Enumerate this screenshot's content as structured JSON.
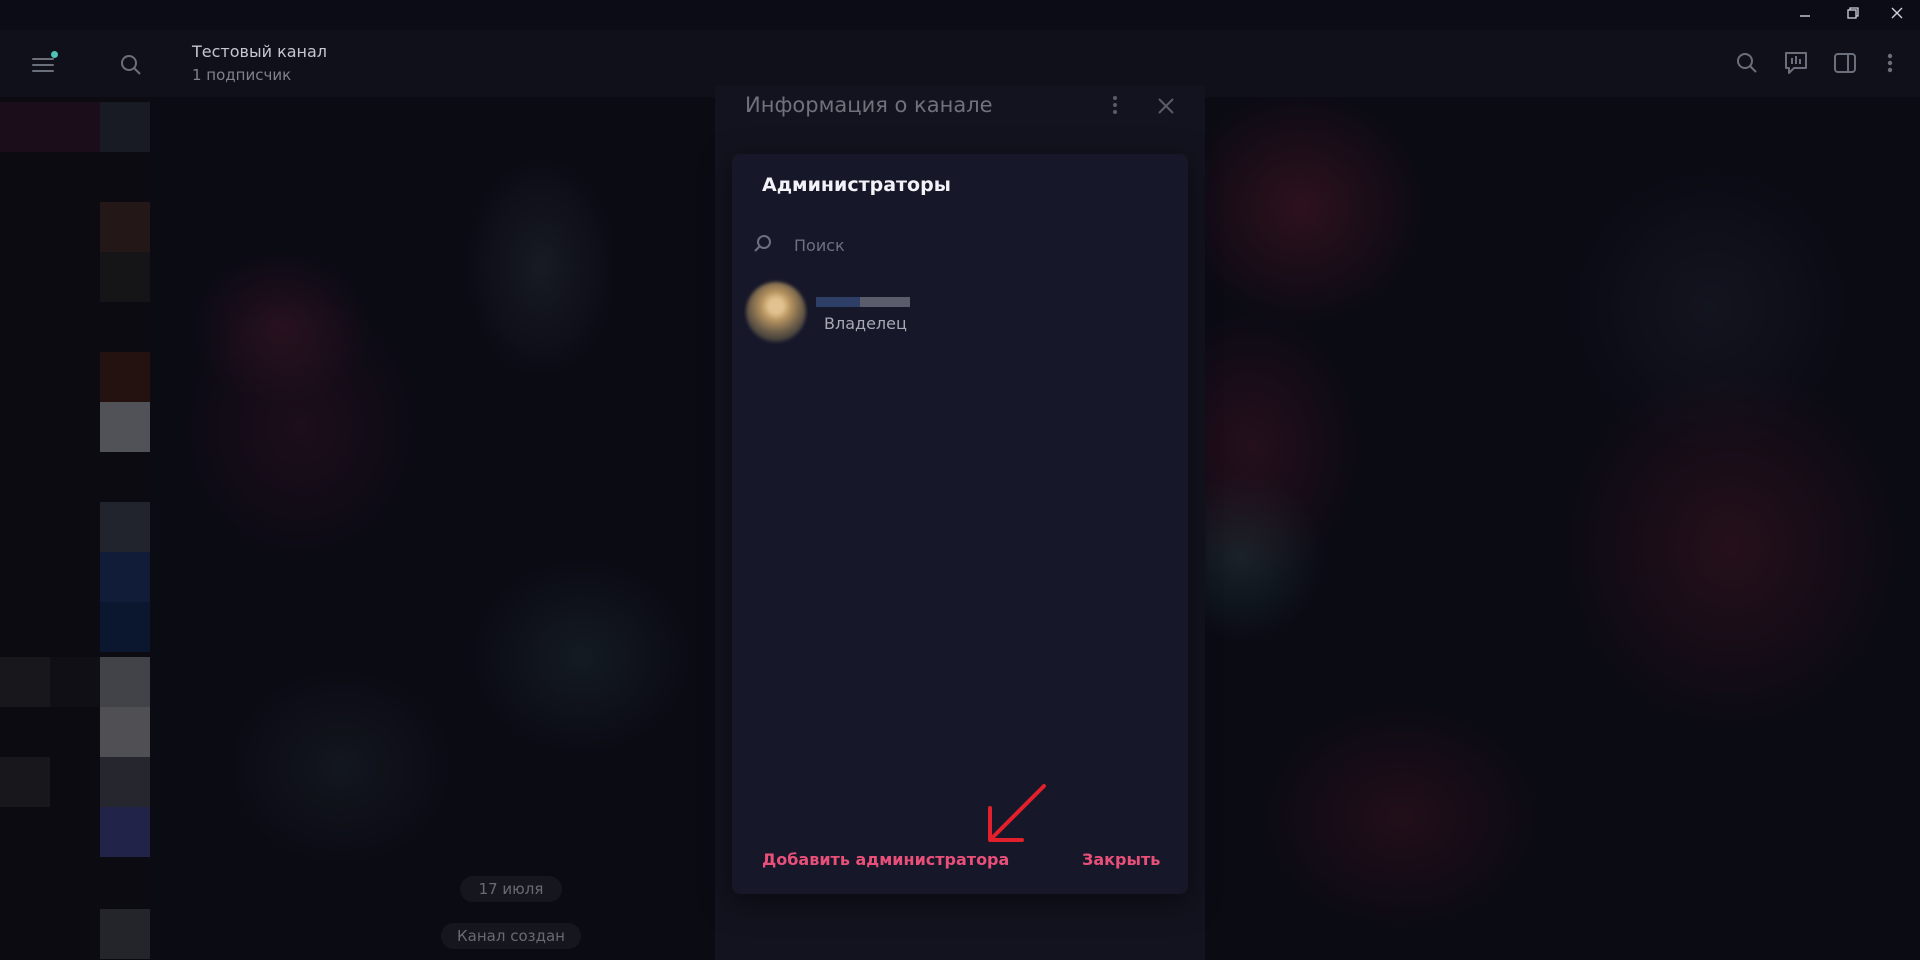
{
  "window": {
    "minimize_icon": "minimize-icon",
    "restore_icon": "restore-icon",
    "close_icon": "close-icon"
  },
  "header": {
    "chat_title": "Тестовый канал",
    "chat_subtitle": "1 подписчик",
    "icons": [
      "menu-icon",
      "search-icon",
      "search-icon",
      "poll-icon",
      "sidebar-toggle-icon",
      "more-vertical-icon"
    ]
  },
  "chat": {
    "date_label": "17 июля",
    "service_message": "Канал создан"
  },
  "info_panel": {
    "title": "Информация о канале"
  },
  "modal": {
    "title": "Администраторы",
    "search_placeholder": "Поиск",
    "members": [
      {
        "name": "",
        "role": "Владелец"
      }
    ],
    "add_button": "Добавить администратора",
    "close_button": "Закрыть"
  },
  "colors": {
    "accent": "#e8507a",
    "modal_bg": "#17172a",
    "header_bg": "#10101b",
    "annotation_arrow": "#e0202a"
  }
}
